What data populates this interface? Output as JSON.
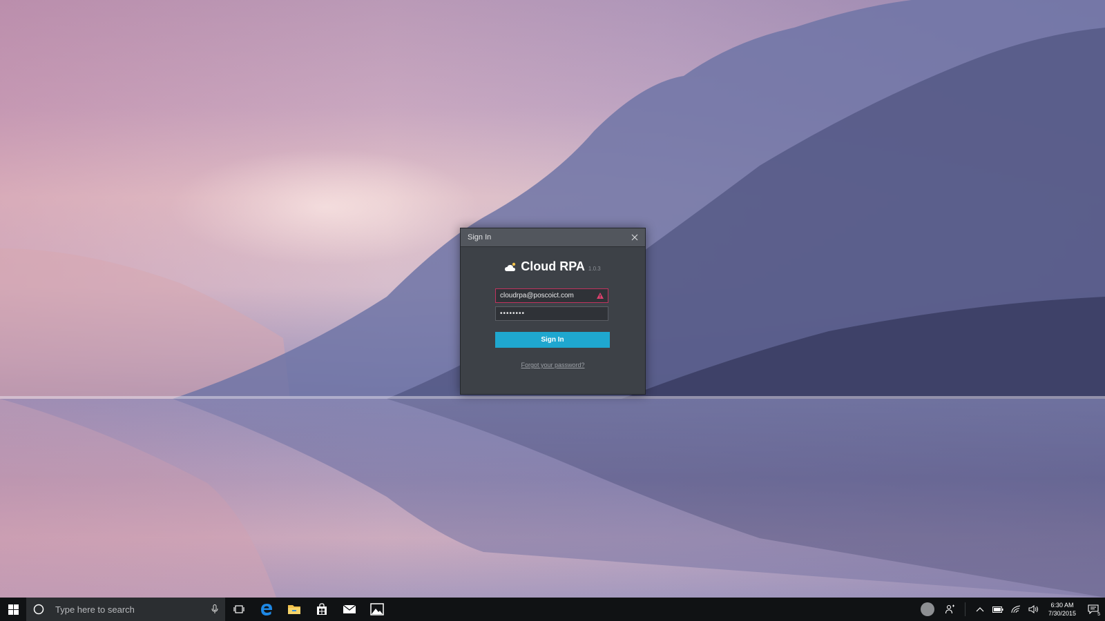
{
  "dialog": {
    "title": "Sign In",
    "brand_name": "Cloud RPA",
    "version": "1.0.3",
    "email_value": "cloudrpa@poscoict.com",
    "password_value": "••••••••",
    "sign_in_label": "Sign In",
    "forgot_label": "Forgot your password?",
    "error_color": "#c2335e",
    "button_color": "#1fa7cf"
  },
  "taskbar": {
    "search_placeholder": "Type here to search",
    "time": "6:30 AM",
    "date": "7/30/2015",
    "notification_count": "5",
    "pinned_icons": [
      "task-view-icon",
      "edge-icon",
      "file-explorer-icon",
      "store-icon",
      "mail-icon",
      "photos-icon"
    ],
    "tray_icons": [
      "people-icon",
      "chevron-up-icon",
      "battery-icon",
      "wifi-icon",
      "volume-icon"
    ]
  }
}
